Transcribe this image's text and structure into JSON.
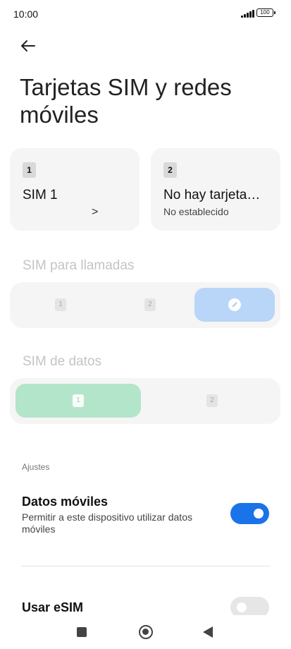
{
  "status_bar": {
    "time": "10:00",
    "battery": "100"
  },
  "page": {
    "title": "Tarjetas SIM y redes móviles"
  },
  "sim_cards": [
    {
      "number": "1",
      "name": "SIM 1",
      "status": ""
    },
    {
      "number": "2",
      "name": "No hay tarjeta…",
      "status": "No establecido"
    }
  ],
  "calls": {
    "label": "SIM para llamadas",
    "options": [
      "1",
      "2"
    ],
    "selected": "ask-icon",
    "accent": "#b9d5f7"
  },
  "data_sim": {
    "label": "SIM de datos",
    "options": [
      "1",
      "2"
    ],
    "selected": "1",
    "accent": "#b3e5ca"
  },
  "settings": {
    "category": "Ajustes",
    "mobile_data": {
      "title": "Datos móviles",
      "description": "Permitir a este dispositivo utilizar datos móviles",
      "enabled": true
    },
    "esim": {
      "title": "Usar eSIM",
      "enabled": false
    }
  },
  "colors": {
    "toggle_on": "#1a73e8",
    "toggle_off": "#e6e6e6"
  }
}
